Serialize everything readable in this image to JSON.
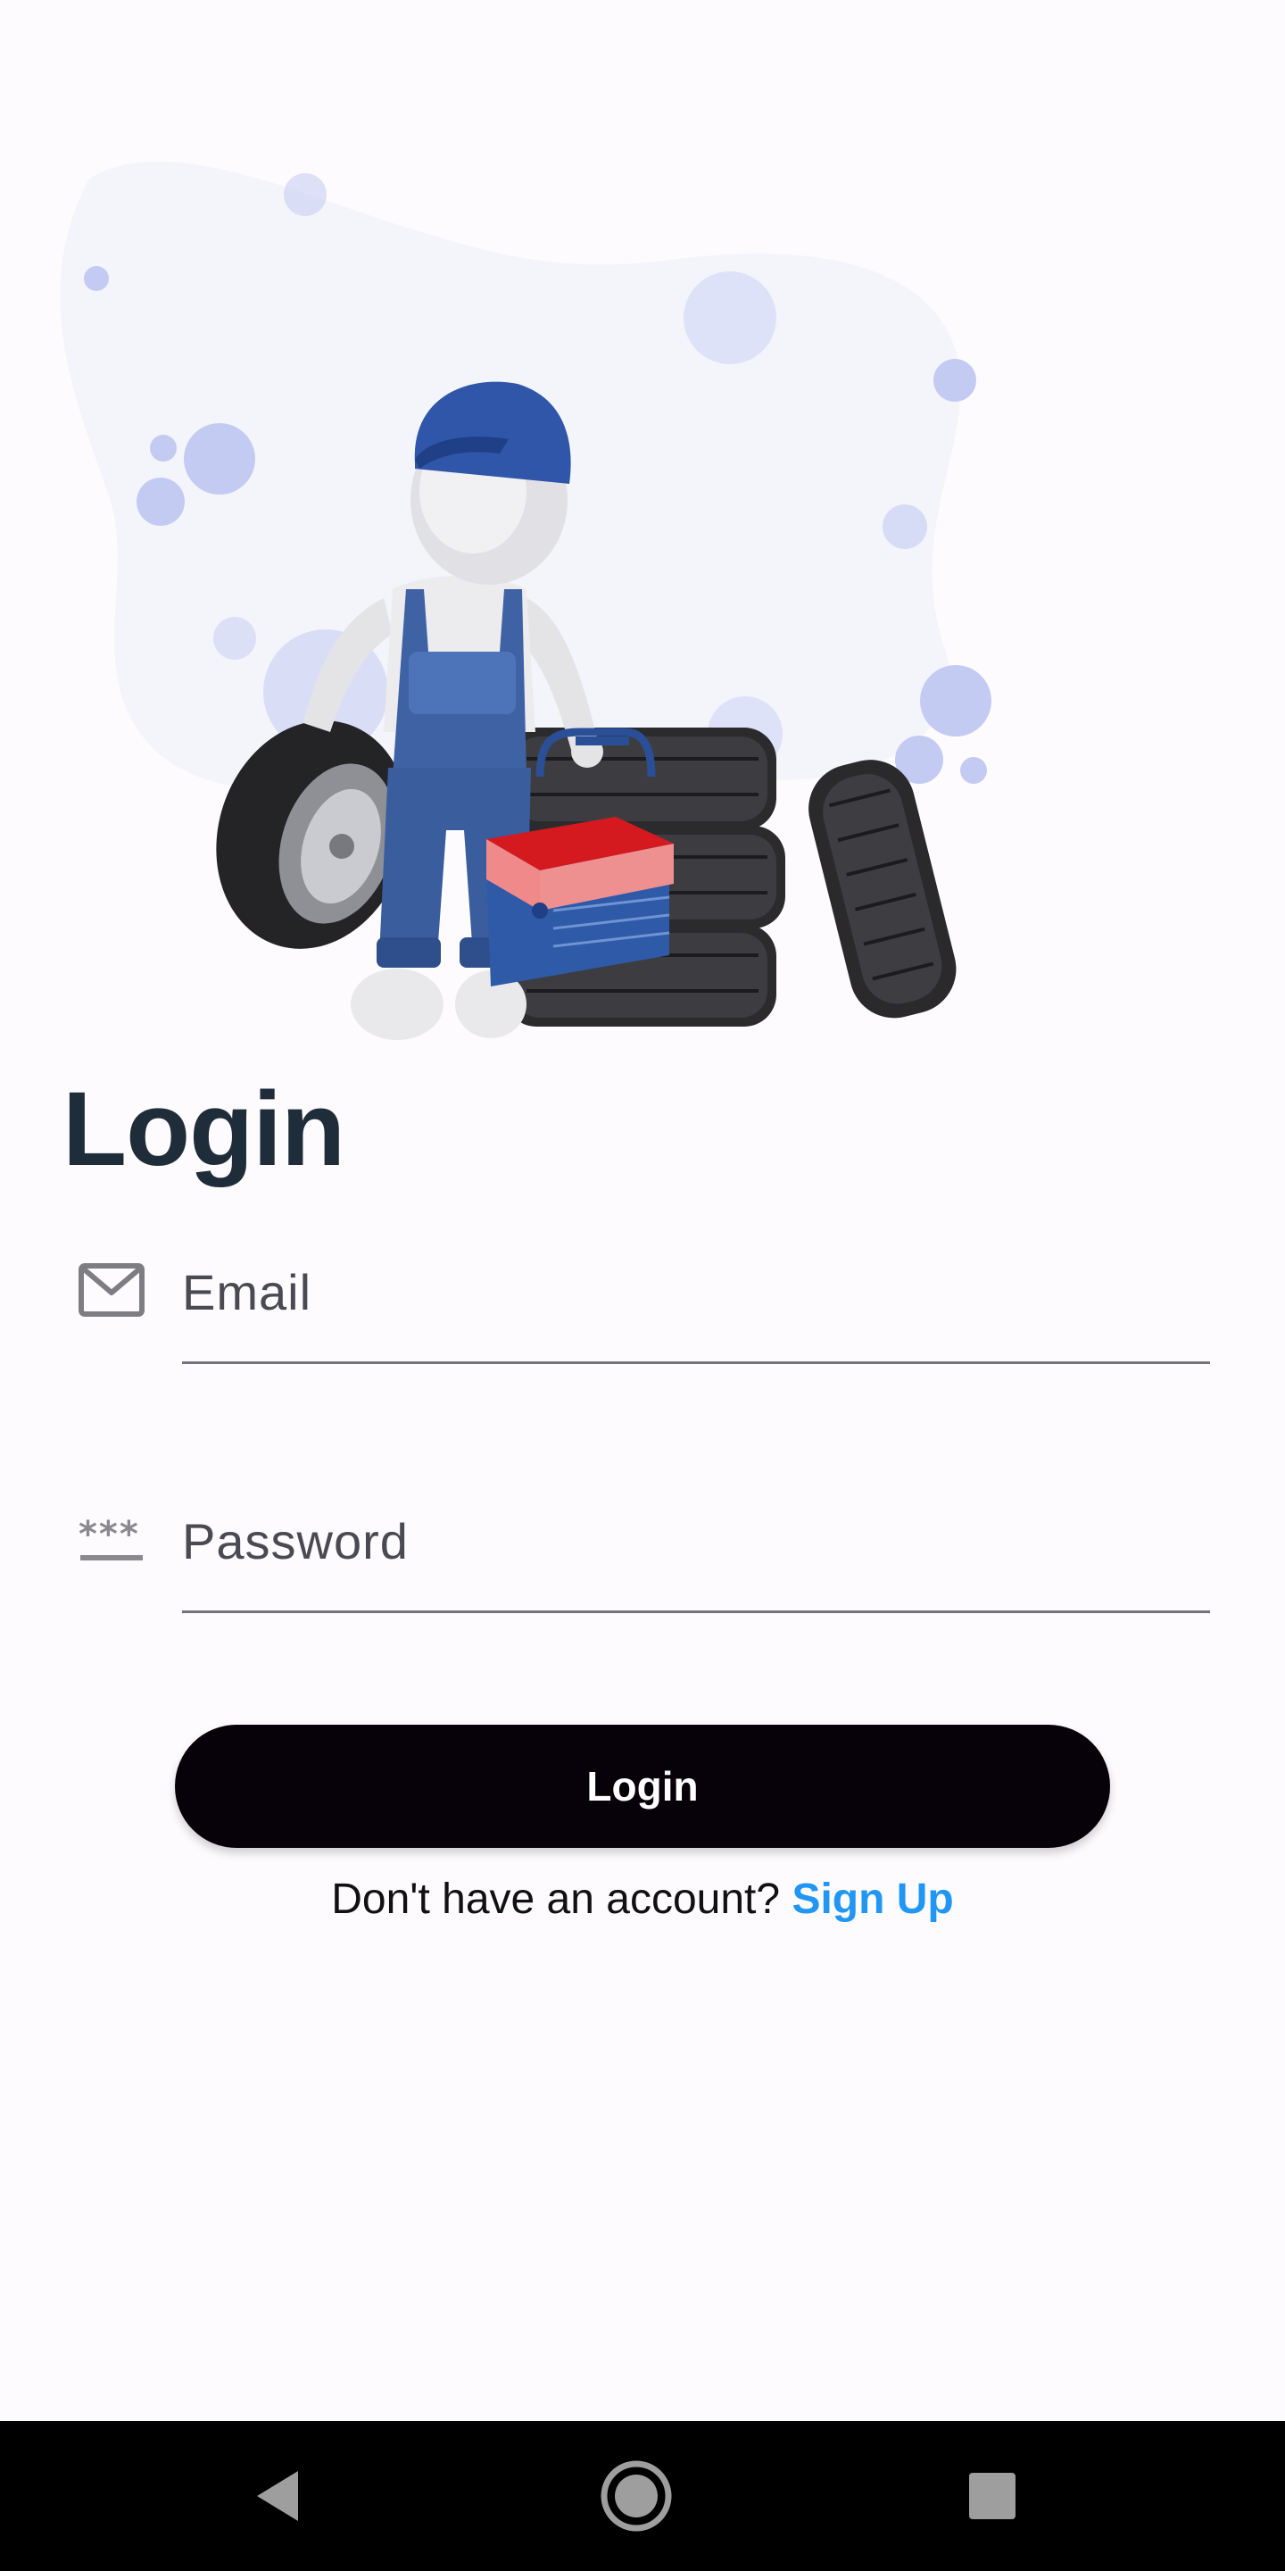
{
  "page": {
    "title": "Login"
  },
  "email": {
    "placeholder": "Email",
    "icon": "mail-icon"
  },
  "password": {
    "placeholder": "Password",
    "icon": "password-icon"
  },
  "login_button": {
    "label": "Login"
  },
  "signup": {
    "prompt": "Don't have an account?",
    "link": "Sign Up"
  },
  "nav": {
    "back_icon": "back-icon",
    "home_icon": "home-icon",
    "recents_icon": "recents-icon"
  },
  "colors": {
    "background": "#fdfbfd",
    "title": "#1f2d3a",
    "button": "#07020a",
    "link": "#2196f3",
    "navbar": "#000000"
  }
}
